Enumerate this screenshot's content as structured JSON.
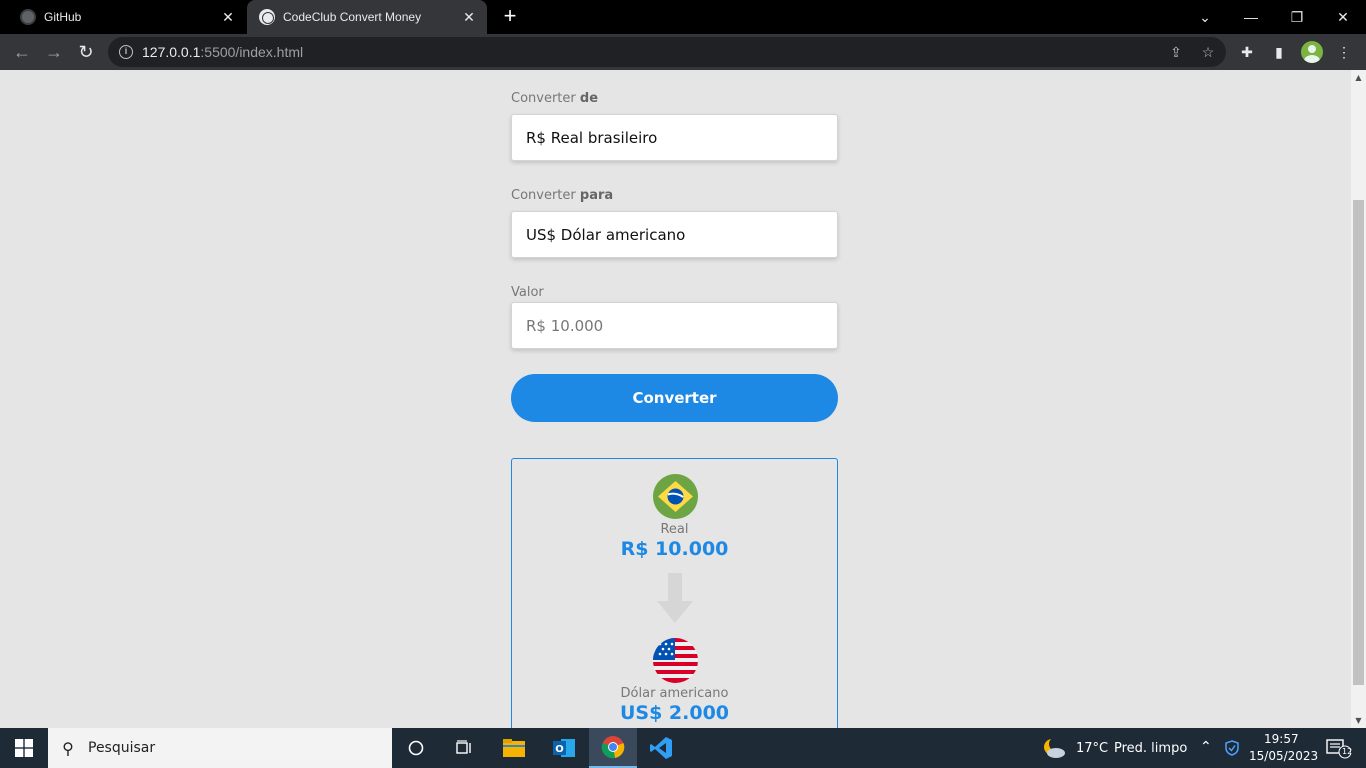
{
  "browser": {
    "tabs": [
      {
        "title": "GitHub"
      },
      {
        "title": "CodeClub Convert Money"
      }
    ],
    "url_host": "127.0.0.1",
    "url_rest": ":5500/index.html"
  },
  "form": {
    "from_label_prefix": "Converter ",
    "from_label_strong": "de",
    "from_value": "R$ Real brasileiro",
    "to_label_prefix": "Converter ",
    "to_label_strong": "para",
    "to_value": "US$ Dólar americano",
    "amount_label": "Valor",
    "amount_placeholder": "R$ 10.000",
    "convert_button": "Converter"
  },
  "result": {
    "from_currency_name": "Real",
    "from_amount": "R$ 10.000",
    "to_currency_name": "Dólar americano",
    "to_amount": "US$ 2.000"
  },
  "taskbar": {
    "search_placeholder": "Pesquisar",
    "weather_temp": "17°C",
    "weather_text": "Pred. limpo",
    "time": "19:57",
    "date": "15/05/2023",
    "notifications_count": "12"
  },
  "colors": {
    "accent": "#1e88e5",
    "page_bg": "#e5e5e5"
  }
}
